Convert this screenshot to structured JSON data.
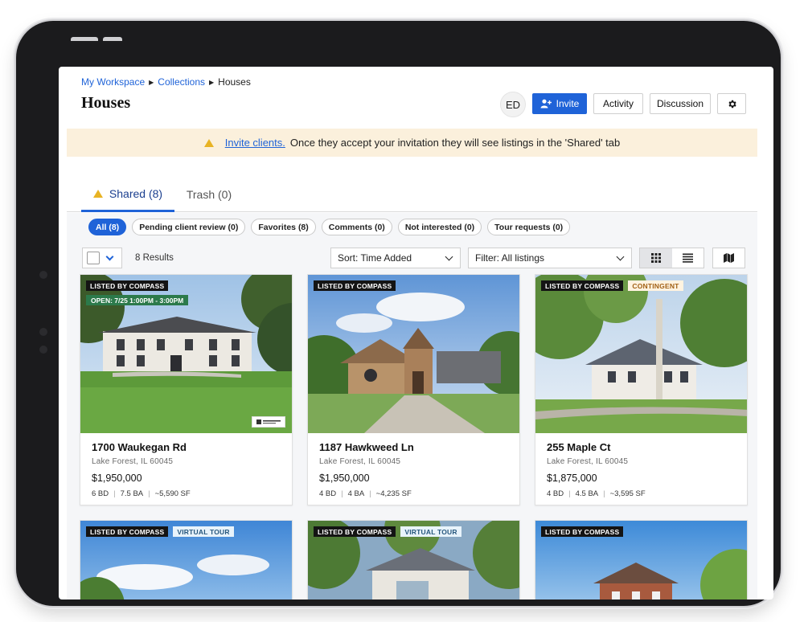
{
  "breadcrumb": {
    "workspace": "My Workspace",
    "collections": "Collections",
    "current": "Houses"
  },
  "page_title": "Houses",
  "header": {
    "avatar_initials": "ED",
    "invite_label": "Invite",
    "activity_label": "Activity",
    "discussion_label": "Discussion",
    "settings_icon": "gear-icon"
  },
  "banner": {
    "link_text": "Invite clients.",
    "text": "Once they accept your invitation they will see listings in the 'Shared' tab"
  },
  "tabs": [
    {
      "label": "Shared (8)",
      "active": true
    },
    {
      "label": "Trash (0)",
      "active": false
    }
  ],
  "filter_chips": [
    {
      "label": "All",
      "count": "(8)"
    },
    {
      "label": "Pending client review",
      "count": "(0)"
    },
    {
      "label": "Favorites",
      "count": "(8)"
    },
    {
      "label": "Comments",
      "count": "(0)"
    },
    {
      "label": "Not interested",
      "count": "(0)"
    },
    {
      "label": "Tour requests",
      "count": "(0)"
    }
  ],
  "toolbar": {
    "results": "8 Results",
    "sort": "Sort: Time Added",
    "filter": "Filter: All listings",
    "grid_icon": "grid-icon",
    "list_icon": "list-icon",
    "map_icon": "map-icon"
  },
  "listings": [
    {
      "badge": "LISTED BY COMPASS",
      "open_house": "OPEN: 7/25 1:00PM - 3:00PM",
      "address": "1700 Waukegan Rd",
      "city": "Lake Forest, IL 60045",
      "price": "$1,950,000",
      "beds": "6 BD",
      "baths": "7.5 BA",
      "sqft": "~5,590 SF"
    },
    {
      "badge": "LISTED BY COMPASS",
      "address": "1187 Hawkweed Ln",
      "city": "Lake Forest, IL 60045",
      "price": "$1,950,000",
      "beds": "4 BD",
      "baths": "4 BA",
      "sqft": "~4,235 SF"
    },
    {
      "badge": "LISTED BY COMPASS",
      "status": "CONTINGENT",
      "address": "255 Maple Ct",
      "city": "Lake Forest, IL 60045",
      "price": "$1,875,000",
      "beds": "4 BD",
      "baths": "4.5 BA",
      "sqft": "~3,595 SF"
    },
    {
      "badge": "LISTED BY COMPASS",
      "tag": "VIRTUAL TOUR"
    },
    {
      "badge": "LISTED BY COMPASS",
      "tag": "VIRTUAL TOUR"
    },
    {
      "badge": "LISTED BY COMPASS"
    }
  ],
  "colors": {
    "primary": "#1f63d8",
    "banner_bg": "#fbf0dc",
    "warning": "#e8b324",
    "open_green": "#2c7a4b"
  }
}
